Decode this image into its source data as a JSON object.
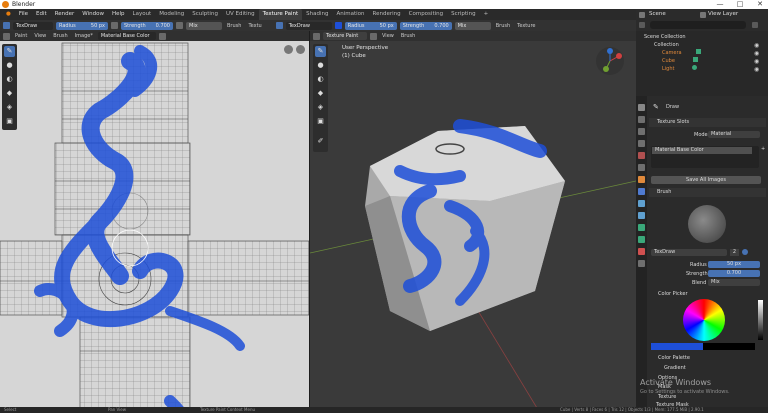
{
  "window": {
    "title": "Blender",
    "controls": [
      "—",
      "□",
      "✕"
    ]
  },
  "menubar": {
    "items": [
      "File",
      "Edit",
      "Render",
      "Window",
      "Help"
    ],
    "workspaces": [
      "Layout",
      "Modeling",
      "Sculpting",
      "UV Editing",
      "Texture Paint",
      "Shading",
      "Animation",
      "Rendering",
      "Compositing",
      "Scripting"
    ],
    "active_workspace": "Texture Paint",
    "add_tab": "+",
    "scene_label": "Scene",
    "view_layer_label": "View Layer"
  },
  "tool_header_left": {
    "brush": "TexDraw",
    "radius_label": "Radius",
    "radius_value": "50 px",
    "strength_label": "Strength",
    "strength_value": "0.700",
    "blend": "Mix",
    "brush_menu": "Brush",
    "texture_menu": "Textu"
  },
  "tool_header_right": {
    "brush": "TexDraw",
    "radius_label": "Radius",
    "radius_value": "50 px",
    "strength_label": "Strength",
    "strength_value": "0.700",
    "blend": "Mix",
    "brush_menu": "Brush",
    "texture_menu": "Texture"
  },
  "image_editor": {
    "mode": "Paint",
    "menus": [
      "View",
      "Brush",
      "Image*"
    ],
    "image_name": "Material Base Color"
  },
  "viewport": {
    "mode": "Texture Paint",
    "menus": [
      "View",
      "Brush"
    ],
    "overlay_title": "User Perspective",
    "overlay_object": "(1) Cube"
  },
  "outliner": {
    "search_placeholder": "",
    "items": [
      {
        "name": "Scene Collection",
        "color": "#dddddd"
      },
      {
        "name": "Collection",
        "color": "#dddddd"
      },
      {
        "name": "Camera",
        "color": "#e0893b"
      },
      {
        "name": "Cube",
        "color": "#e0893b"
      },
      {
        "name": "Light",
        "color": "#e0893b"
      }
    ]
  },
  "properties": {
    "tool_name": "Draw",
    "texture_slots_label": "Texture Slots",
    "mode_label": "Mode",
    "mode_value": "Material",
    "slot_name": "Material Base Color",
    "save_all_images": "Save All Images",
    "brush_label": "Brush",
    "brush_name": "TexDraw",
    "brush_users": "2",
    "radius_label": "Radius",
    "radius_value": "50 px",
    "strength_label": "Strength",
    "strength_value": "0.700",
    "blend_label": "Blend",
    "blend_value": "Mix",
    "color_picker_label": "Color Picker",
    "color_palette_label": "Color Palette",
    "gradient_label": "Gradient",
    "options_label": "Options",
    "mask_label": "Mask",
    "texture_label": "Texture",
    "texture_mask_label": "Texture Mask",
    "paint_color": "#1e4fd8"
  },
  "watermark": {
    "title": "Activate Windows",
    "subtitle": "Go to Settings to activate Windows."
  },
  "statusbar": {
    "left": "Select",
    "mid": "Pan View",
    "center": "Texture Paint Context Menu",
    "right": "Cube | Verts 8 | Faces 6 | Tris 12 | Objects 1/3 | Mem: 177.5 MiB | 2.90.1"
  },
  "colors": {
    "accent_blue": "#4772b3",
    "paint_blue": "#1e4fd8",
    "object_orange": "#e0893b"
  }
}
